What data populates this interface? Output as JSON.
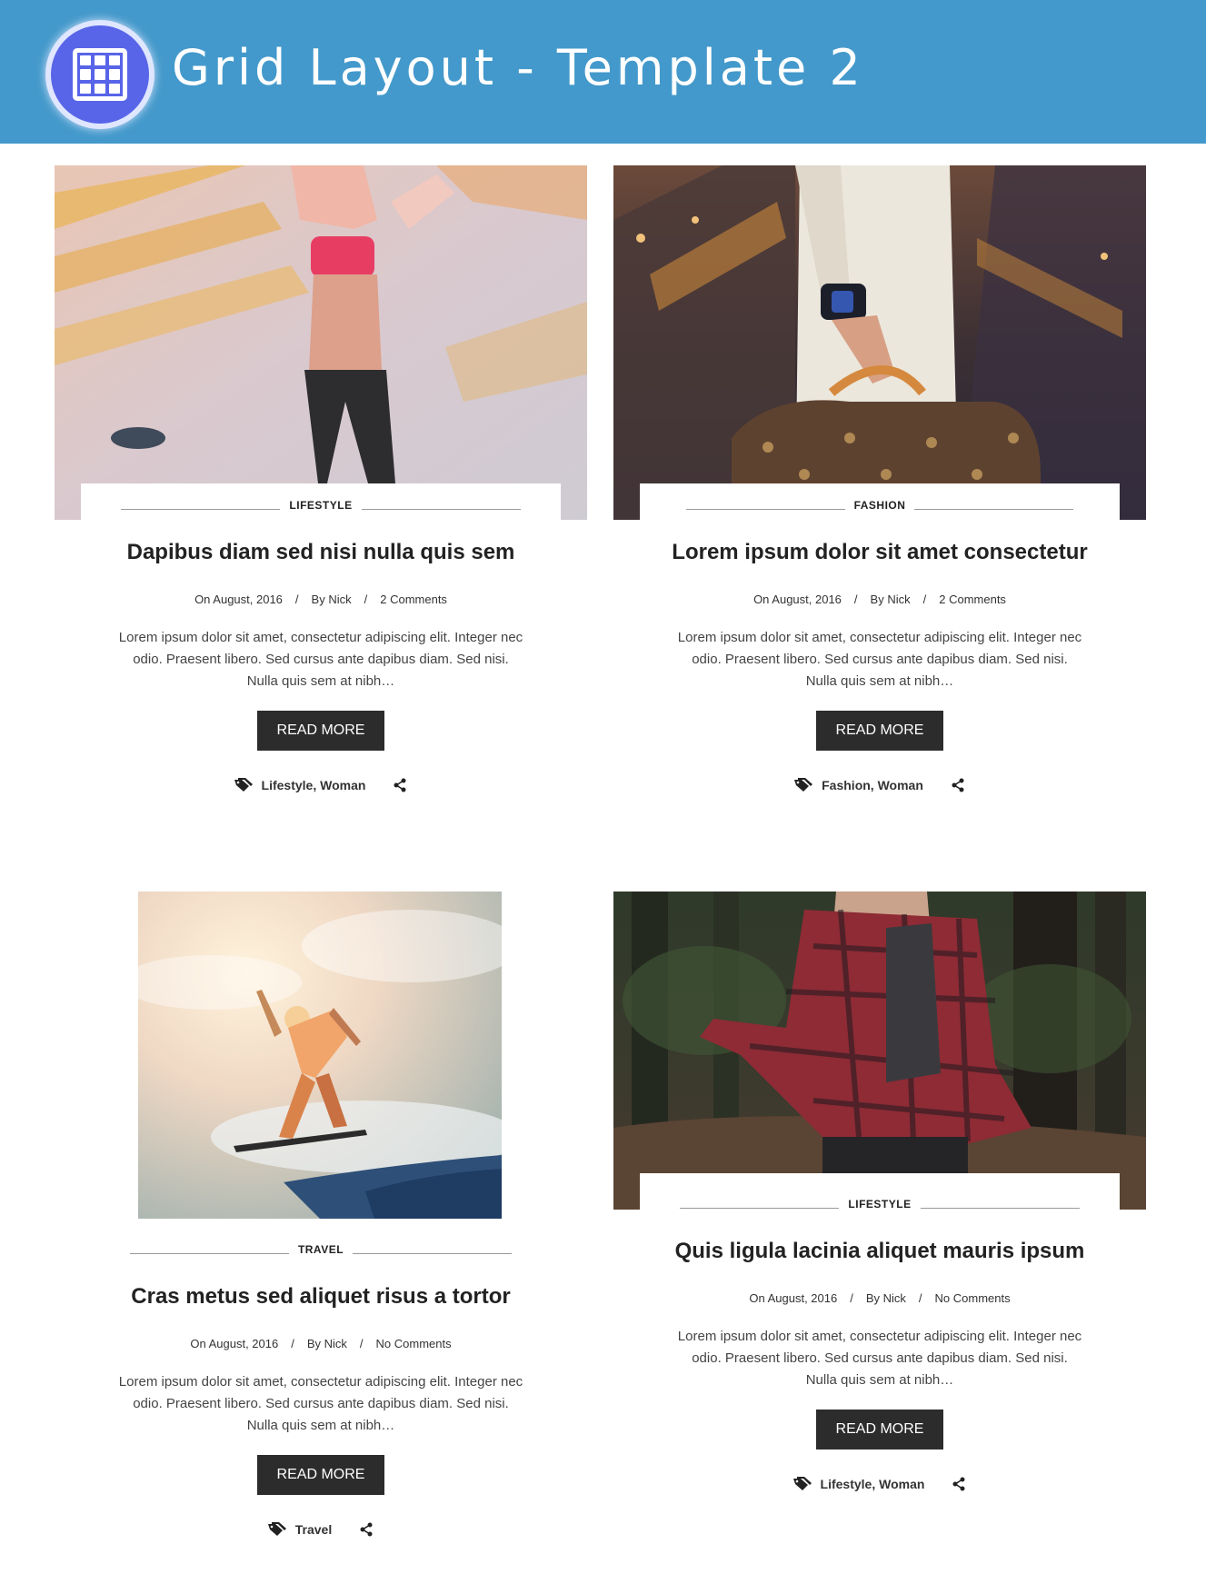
{
  "header": {
    "title": "Grid Layout - Template 2",
    "logo_icon": "grid-icon",
    "background_color": "#4399cb"
  },
  "posts": [
    {
      "category": "LIFESTYLE",
      "title": "Dapibus diam sed nisi nulla quis sem",
      "date": "On August, 2016",
      "author": "By Nick",
      "comments": "2 Comments",
      "excerpt": "Lorem ipsum dolor sit amet, consectetur adipiscing elit. Integer nec odio. Praesent libero. Sed cursus ante dapibus diam. Sed nisi. Nulla quis sem at nibh…",
      "read_more": "READ MORE",
      "tags": "Lifestyle, Woman"
    },
    {
      "category": "FASHION",
      "title": "Lorem ipsum dolor sit amet consectetur",
      "date": "On August, 2016",
      "author": "By Nick",
      "comments": "2 Comments",
      "excerpt": "Lorem ipsum dolor sit amet, consectetur adipiscing elit. Integer nec odio. Praesent libero. Sed cursus ante dapibus diam. Sed nisi. Nulla quis sem at nibh…",
      "read_more": "READ MORE",
      "tags": "Fashion, Woman"
    },
    {
      "category": "TRAVEL",
      "title": "Cras metus sed aliquet risus a tortor",
      "date": "On August, 2016",
      "author": "By Nick",
      "comments": "No Comments",
      "excerpt": "Lorem ipsum dolor sit amet, consectetur adipiscing elit. Integer nec odio. Praesent libero. Sed cursus ante dapibus diam. Sed nisi. Nulla quis sem at nibh…",
      "read_more": "READ MORE",
      "tags": "Travel"
    },
    {
      "category": "LIFESTYLE",
      "title": "Quis ligula lacinia aliquet mauris ipsum",
      "date": "On August, 2016",
      "author": "By Nick",
      "comments": "No Comments",
      "excerpt": "Lorem ipsum dolor sit amet, consectetur adipiscing elit. Integer nec odio. Praesent libero. Sed cursus ante dapibus diam. Sed nisi. Nulla quis sem at nibh…",
      "read_more": "READ MORE",
      "tags": "Lifestyle, Woman"
    }
  ],
  "meta_separator": "/",
  "icons": {
    "tag": "tag-icon",
    "share": "share-icon"
  }
}
